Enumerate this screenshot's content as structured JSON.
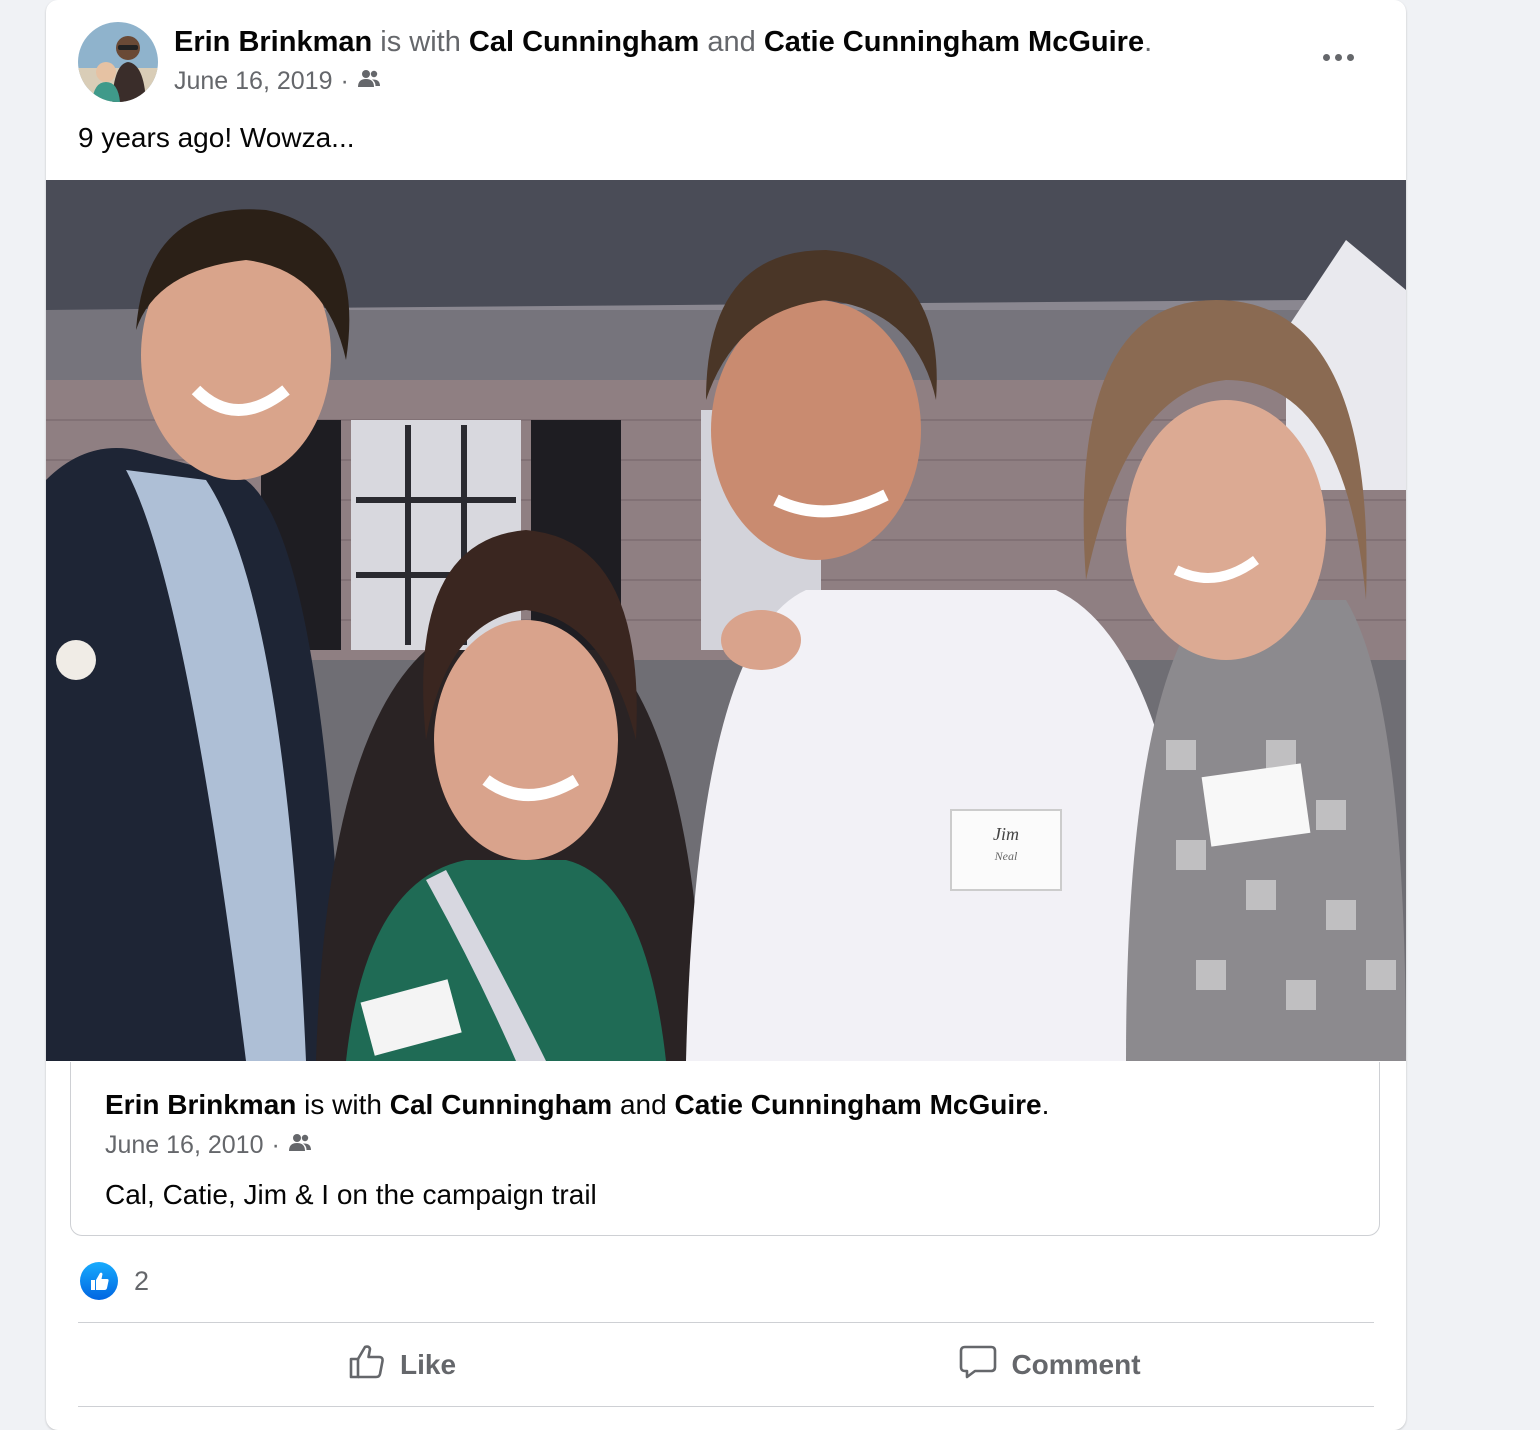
{
  "post": {
    "author": "Erin Brinkman",
    "with_text": "is with",
    "tag1": "Cal Cunningham",
    "and_text": "and",
    "tag2": "Catie Cunningham McGuire",
    "period": ".",
    "date": "June 16, 2019",
    "separator": "·",
    "audience_icon": "friends-icon",
    "text": "9 years ago! Wowza..."
  },
  "photo": {
    "name_tag": "Jim",
    "name_tag_line2": "Neal"
  },
  "shared": {
    "author": "Erin Brinkman",
    "with_text": "is with",
    "tag1": "Cal Cunningham",
    "and_text": "and",
    "tag2": "Catie Cunningham McGuire",
    "period": ".",
    "date": "June 16, 2010",
    "separator": "·",
    "text": "Cal, Catie, Jim & I on the campaign trail"
  },
  "reactions": {
    "icon": "like-reaction-icon",
    "count": "2"
  },
  "actions": {
    "like": "Like",
    "comment": "Comment"
  },
  "colors": {
    "brand_blue": "#1877f2",
    "secondary_text": "#65676b",
    "divider": "#ced0d4"
  }
}
